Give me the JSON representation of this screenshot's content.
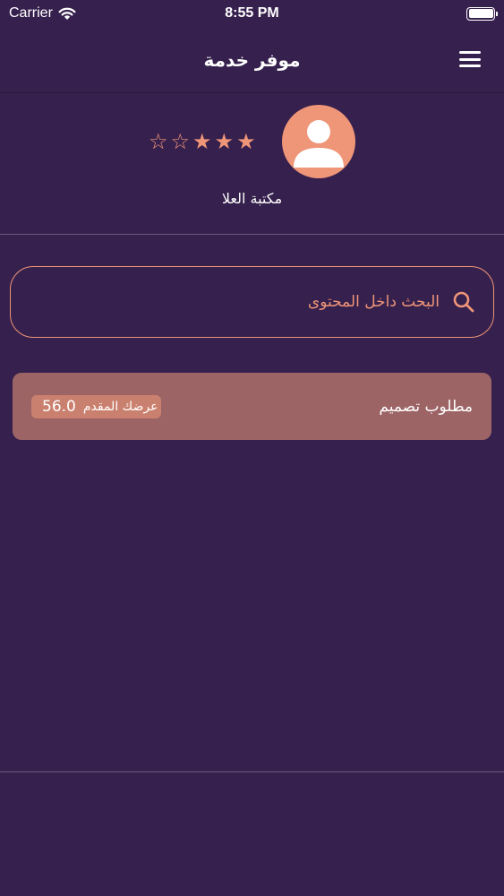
{
  "status_bar": {
    "carrier": "Carrier",
    "time": "8:55 PM",
    "wifi_icon": "wifi-icon",
    "battery_icon": "battery-icon"
  },
  "nav": {
    "title": "موفر خدمة",
    "menu_icon": "hamburger-menu-icon"
  },
  "profile": {
    "name": "مكتبة العلا",
    "avatar_icon": "user-avatar-icon",
    "rating": 3,
    "rating_max": 5,
    "stars": [
      "★",
      "★",
      "★",
      "☆",
      "☆"
    ]
  },
  "search": {
    "placeholder": "البحث داخل المحتوى",
    "icon": "search-icon"
  },
  "requests": [
    {
      "title": "مطلوب تصميم",
      "offer_label": "عرضك المقدم",
      "offer_value": "56.0"
    }
  ],
  "colors": {
    "background": "#36204d",
    "accent": "#ef9578",
    "card": "#9d6466",
    "badge": "#ca806e"
  }
}
